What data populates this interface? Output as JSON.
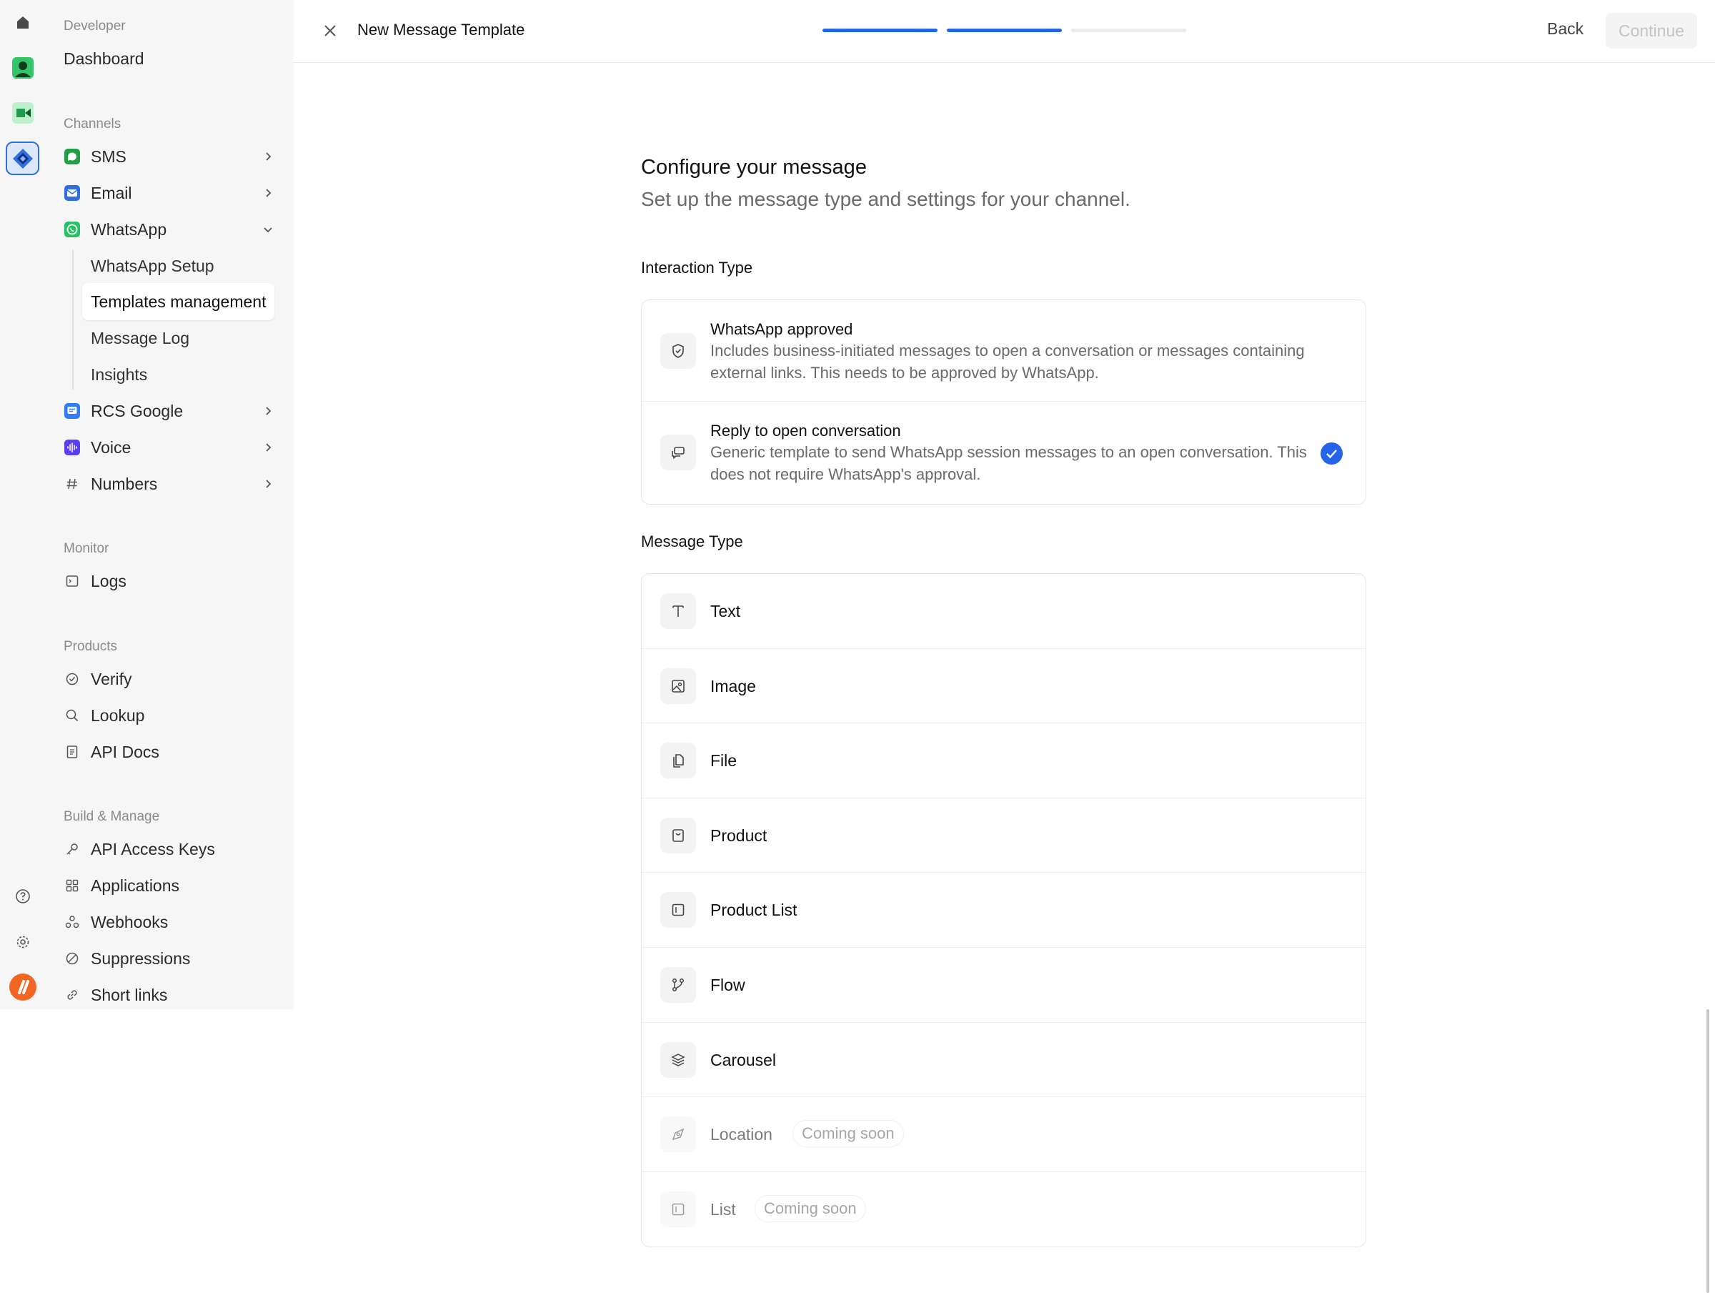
{
  "colors": {
    "accent": "#2563eb",
    "progress_track": "#ececec",
    "sms_green": "#22a047",
    "email_blue": "#2f6fe0",
    "whatsapp_green": "#25c165",
    "rcs_blue": "#2f7df6",
    "voice_purple": "#5b3df5",
    "brand_orange": "#f26522"
  },
  "rail": {
    "icons": [
      "home-icon",
      "contact-app-icon",
      "video-app-icon",
      "developer-app-icon",
      "help-icon",
      "settings-icon",
      "brand-logo-icon"
    ]
  },
  "sidebar": {
    "section_developer": "Developer",
    "dashboard": "Dashboard",
    "section_channels": "Channels",
    "channels": [
      {
        "label": "SMS",
        "icon": "sms-icon"
      },
      {
        "label": "Email",
        "icon": "email-icon"
      },
      {
        "label": "WhatsApp",
        "icon": "whatsapp-icon"
      },
      {
        "label": "RCS Google",
        "icon": "rcs-icon"
      },
      {
        "label": "Voice",
        "icon": "voice-icon"
      },
      {
        "label": "Numbers",
        "icon": "hash-icon"
      }
    ],
    "whatsapp_sub": [
      "WhatsApp Setup",
      "Templates management",
      "Message Log",
      "Insights"
    ],
    "section_monitor": "Monitor",
    "logs": "Logs",
    "section_products": "Products",
    "products": [
      "Verify",
      "Lookup",
      "API Docs"
    ],
    "section_build": "Build & Manage",
    "build": [
      "API Access Keys",
      "Applications",
      "Webhooks",
      "Suppressions",
      "Short links"
    ]
  },
  "topbar": {
    "title": "New Message Template",
    "steps_completed": 2,
    "steps_total": 3,
    "back": "Back",
    "continue": "Continue"
  },
  "main": {
    "heading": "Configure your message",
    "subheading": "Set up the message type and settings for your channel.",
    "interaction_label": "Interaction Type",
    "interaction_options": [
      {
        "title": "WhatsApp approved",
        "desc": "Includes business-initiated messages to open a conversation or messages containing external links. This needs to be approved by WhatsApp.",
        "selected": false
      },
      {
        "title": "Reply to open conversation",
        "desc": "Generic template to send WhatsApp session messages to an open conversation. This does not require WhatsApp's approval.",
        "selected": true
      }
    ],
    "message_type_label": "Message Type",
    "message_types": [
      {
        "name": "Text",
        "icon": "text-icon"
      },
      {
        "name": "Image",
        "icon": "image-icon"
      },
      {
        "name": "File",
        "icon": "file-icon"
      },
      {
        "name": "Product",
        "icon": "product-icon"
      },
      {
        "name": "Product List",
        "icon": "product-list-icon"
      },
      {
        "name": "Flow",
        "icon": "flow-icon"
      },
      {
        "name": "Carousel",
        "icon": "carousel-icon"
      },
      {
        "name": "Location",
        "icon": "location-icon",
        "badge": "Coming soon"
      },
      {
        "name": "List",
        "icon": "list-icon",
        "badge": "Coming soon"
      }
    ]
  }
}
